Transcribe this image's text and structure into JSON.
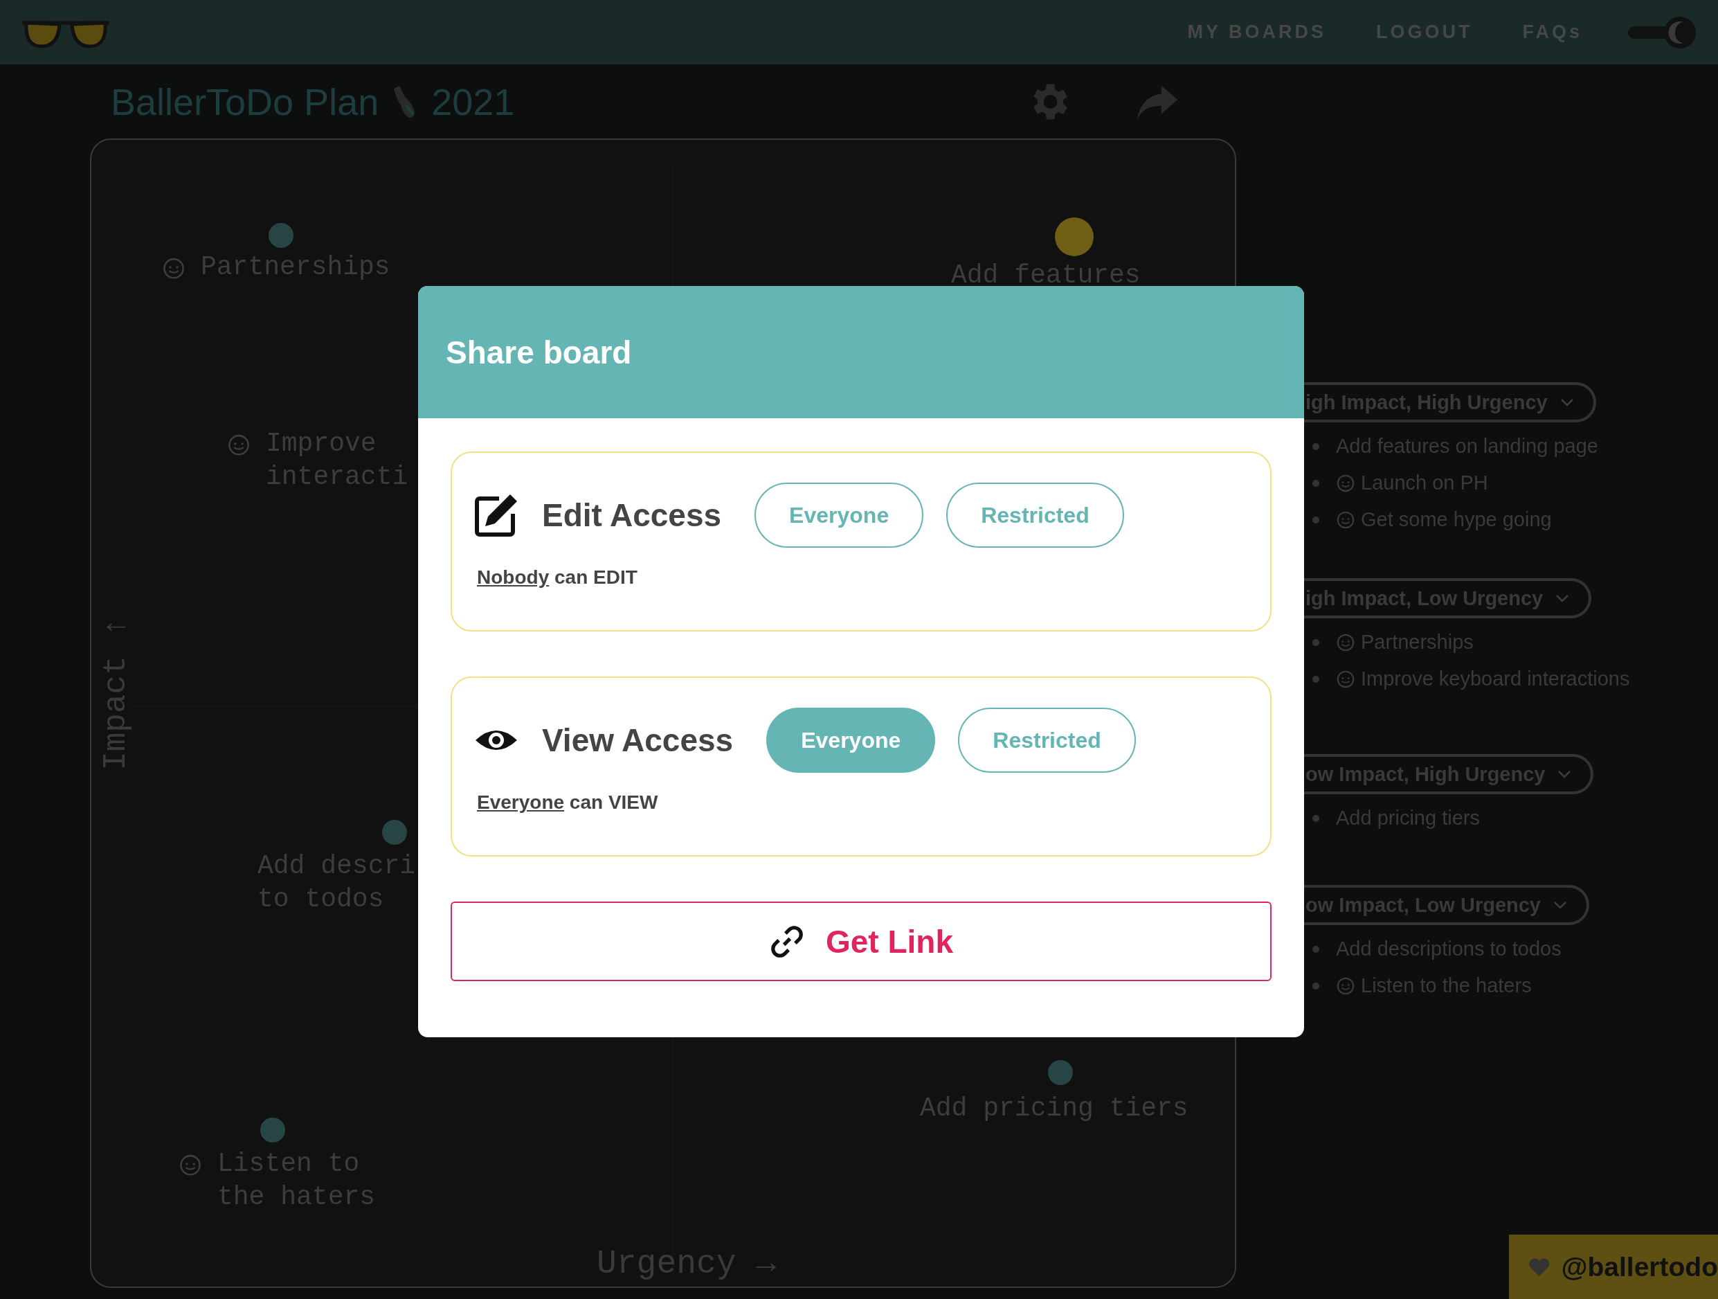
{
  "nav": {
    "links": [
      "MY BOARDS",
      "LOGOUT",
      "FAQs"
    ],
    "dark_mode": true
  },
  "board": {
    "title": "BallerToDo Plan",
    "year": "2021",
    "y_axis": "Impact ↑",
    "x_axis": "Urgency →",
    "todos": [
      {
        "text": "Partnerships",
        "kind": "emoji",
        "color": "#274545"
      },
      {
        "text": "Add features",
        "kind": "plain",
        "color": "#6e5f14"
      },
      {
        "text": "Improve\ninteracti",
        "kind": "emoji"
      },
      {
        "text": "Add descri\nto todos",
        "kind": "plain",
        "color": "#274545"
      },
      {
        "text": "Add pricing tiers",
        "kind": "plain",
        "color": "#274545"
      },
      {
        "text": "Listen to\nthe haters",
        "kind": "emoji",
        "color": "#274545"
      }
    ]
  },
  "sidebar": {
    "groups": [
      {
        "title": "igh Impact, High Urgency",
        "items": [
          {
            "text": "Add features on landing page",
            "kind": "plain"
          },
          {
            "text": "Launch on PH",
            "kind": "emoji"
          },
          {
            "text": "Get some hype going",
            "kind": "emoji"
          }
        ]
      },
      {
        "title": "igh Impact, Low Urgency",
        "items": [
          {
            "text": "Partnerships",
            "kind": "emoji"
          },
          {
            "text": "Improve keyboard interactions",
            "kind": "emoji"
          }
        ]
      },
      {
        "title": "ow Impact, High Urgency",
        "items": [
          {
            "text": "Add pricing tiers",
            "kind": "plain"
          }
        ]
      },
      {
        "title": "ow Impact, Low Urgency",
        "items": [
          {
            "text": "Add descriptions to todos",
            "kind": "plain"
          },
          {
            "text": "Listen to the haters",
            "kind": "emoji"
          }
        ]
      }
    ]
  },
  "modal": {
    "title": "Share board",
    "sections": [
      {
        "kind": "edit",
        "title": "Edit Access",
        "options": [
          {
            "label": "Everyone",
            "selected": false
          },
          {
            "label": "Restricted",
            "selected": false
          }
        ],
        "who": "Nobody",
        "summary": "can EDIT"
      },
      {
        "kind": "view",
        "title": "View Access",
        "options": [
          {
            "label": "Everyone",
            "selected": true
          },
          {
            "label": "Restricted",
            "selected": false
          }
        ],
        "who": "Everyone",
        "summary": "can VIEW"
      }
    ],
    "get_link": "Get Link"
  },
  "badge": "@ballertodo"
}
